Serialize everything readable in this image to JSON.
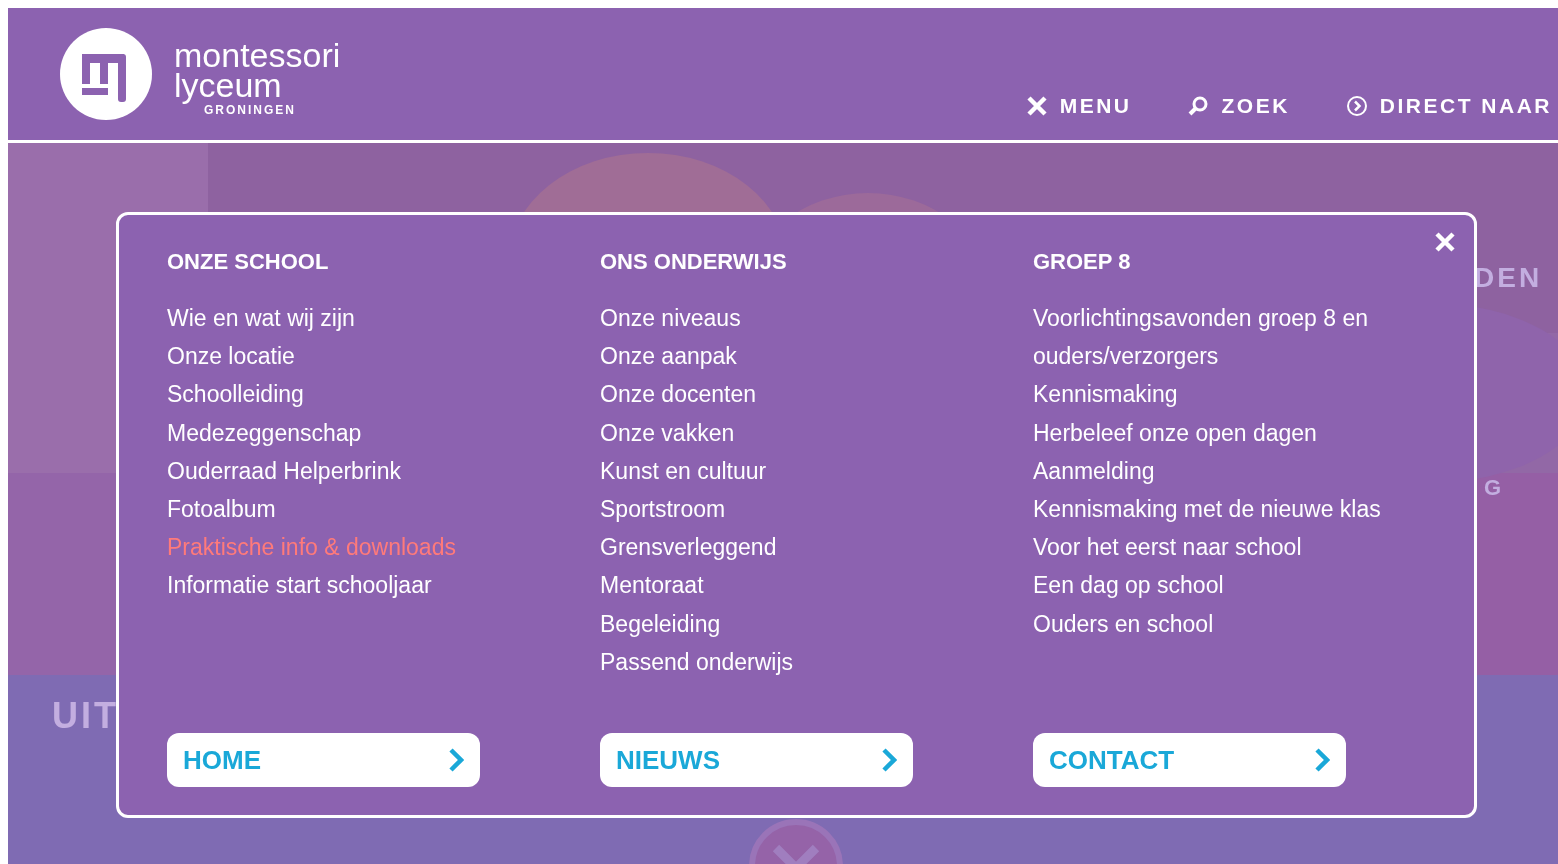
{
  "header": {
    "logo": {
      "line_1": "montessori",
      "line_2": "lyceum",
      "line_3": "GRONINGEN"
    },
    "nav": [
      {
        "kind": "close",
        "label": "MENU"
      },
      {
        "kind": "search",
        "label": "ZOEK"
      },
      {
        "kind": "direct",
        "label": "DIRECT NAAR"
      }
    ]
  },
  "background_texts": [
    "UIT",
    "DEN",
    "G"
  ],
  "menu": {
    "columns": [
      {
        "heading": "ONZE SCHOOL",
        "items": [
          {
            "label": "Wie en wat wij zijn",
            "selected": false
          },
          {
            "label": "Onze locatie",
            "selected": false
          },
          {
            "label": "Schoolleiding",
            "selected": false
          },
          {
            "label": "Medezeggenschap",
            "selected": false
          },
          {
            "label": "Ouderraad Helperbrink",
            "selected": false
          },
          {
            "label": "Fotoalbum",
            "selected": false
          },
          {
            "label": "Praktische info & downloads",
            "selected": true
          },
          {
            "label": "Informatie start schooljaar",
            "selected": false
          }
        ],
        "button": "HOME"
      },
      {
        "heading": "ONS ONDERWIJS",
        "items": [
          {
            "label": "Onze niveaus",
            "selected": false
          },
          {
            "label": "Onze aanpak",
            "selected": false
          },
          {
            "label": "Onze docenten",
            "selected": false
          },
          {
            "label": "Onze vakken",
            "selected": false
          },
          {
            "label": "Kunst en cultuur",
            "selected": false
          },
          {
            "label": "Sportstroom",
            "selected": false
          },
          {
            "label": "Grensverleggend",
            "selected": false
          },
          {
            "label": "Mentoraat",
            "selected": false
          },
          {
            "label": "Begeleiding",
            "selected": false
          },
          {
            "label": "Passend onderwijs",
            "selected": false
          }
        ],
        "button": "NIEUWS"
      },
      {
        "heading": "GROEP 8",
        "items": [
          {
            "label": "Voorlichtingsavonden groep 8 en ouders/verzorgers",
            "selected": false
          },
          {
            "label": "Kennismaking",
            "selected": false
          },
          {
            "label": "Herbeleef onze open dagen",
            "selected": false
          },
          {
            "label": "Aanmelding",
            "selected": false
          },
          {
            "label": "Kennismaking met de nieuwe klas",
            "selected": false
          },
          {
            "label": "Voor het eerst naar school",
            "selected": false
          },
          {
            "label": "Een dag op school",
            "selected": false
          },
          {
            "label": "Ouders en school",
            "selected": false
          }
        ],
        "button": "CONTACT"
      }
    ]
  }
}
